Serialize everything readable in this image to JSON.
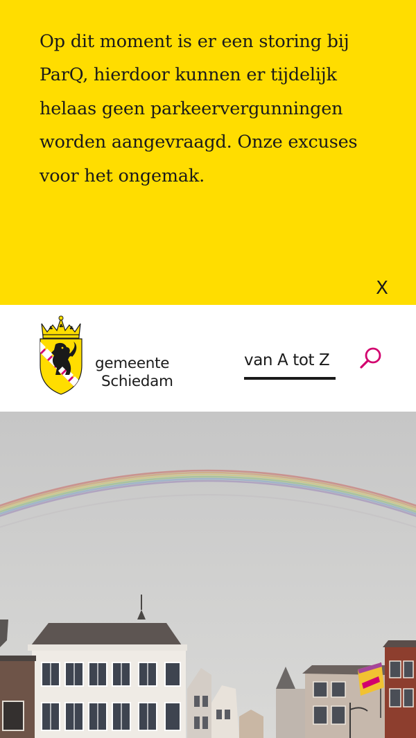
{
  "notice": {
    "message": "Op dit moment is er een storing bij ParQ, hierdoor kunnen er tijdelijk helaas geen parkeervergunningen worden aangevraagd. Onze excuses voor het ongemak.",
    "close_label": "X",
    "background_color": "#ffdd00"
  },
  "header": {
    "logo": {
      "line1": "gemeente",
      "line2": "Schiedam",
      "icon": "coat-of-arms-icon"
    },
    "az_link": "van A tot Z",
    "search_icon": "search-icon",
    "accent_color": "#d2006e"
  },
  "hero": {
    "image": "rainbow-over-schiedam-street-photo"
  }
}
